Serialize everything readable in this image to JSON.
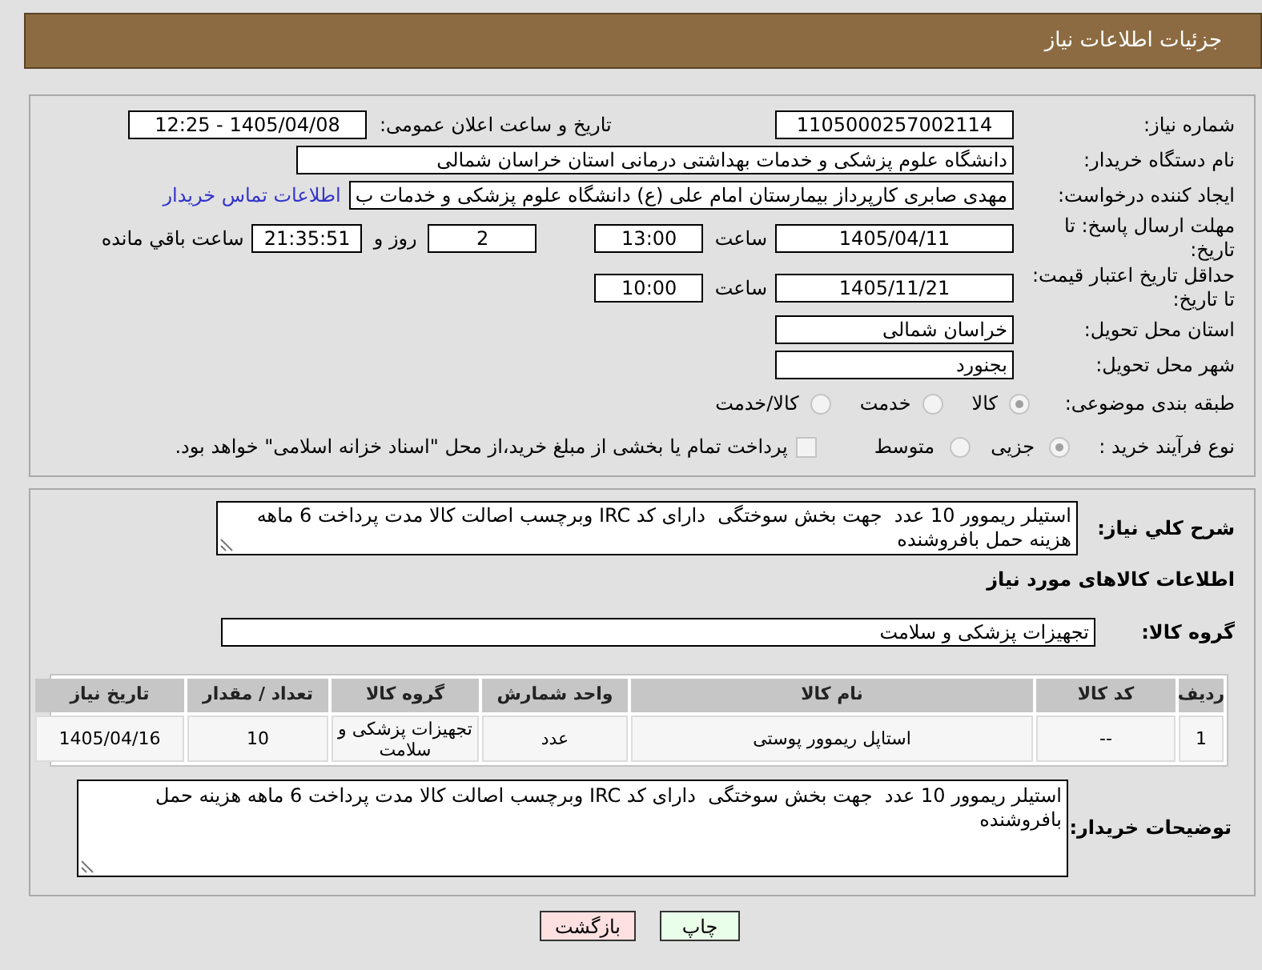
{
  "header": {
    "title": "جزئیات اطلاعات نیاز"
  },
  "fields": {
    "need_number": {
      "label": "شماره نیاز:",
      "value": "1105000257002114"
    },
    "announcement": {
      "label": "تاریخ و ساعت اعلان عمومی:",
      "value": "1405/04/08 - 12:25"
    },
    "buyer_org": {
      "label": "نام دستگاه خریدار:",
      "value": "دانشگاه علوم پزشکی و خدمات بهداشتی درمانی استان خراسان شمالی"
    },
    "requester": {
      "label": "ایجاد کننده درخواست:",
      "value": "مهدی صابری کارپرداز بیمارستان امام علی (ع) دانشگاه علوم پزشکی و خدمات ب",
      "link": "اطلاعات تماس خریدار"
    },
    "response_deadline": {
      "label": "مهلت ارسال پاسخ: تا تاریخ:",
      "date": "1405/04/11",
      "time_label": "ساعت",
      "time": "13:00",
      "days": "2",
      "days_label": "روز و",
      "remaining": "21:35:51",
      "remaining_label": "ساعت باقي مانده"
    },
    "price_validity": {
      "label": "حداقل تاریخ اعتبار قیمت: تا تاریخ:",
      "date": "1405/11/21",
      "time_label": "ساعت",
      "time": "10:00"
    },
    "delivery_province": {
      "label": "استان محل تحویل:",
      "value": "خراسان شمالی"
    },
    "delivery_city": {
      "label": "شهر محل تحویل:",
      "value": "بجنورد"
    },
    "subject_category": {
      "label": "طبقه بندی موضوعی:",
      "options": [
        {
          "label": "کالا",
          "selected": true
        },
        {
          "label": "خدمت",
          "selected": false
        },
        {
          "label": "کالا/خدمت",
          "selected": false
        }
      ]
    },
    "purchase_process": {
      "label": "نوع فرآیند خرید :",
      "options": [
        {
          "label": "جزیی",
          "selected": true
        },
        {
          "label": "متوسط",
          "selected": false
        }
      ],
      "treasury_payment": {
        "label": "پرداخت تمام یا بخشی از مبلغ خرید،از محل \"اسناد خزانه اسلامی\" خواهد بود.",
        "checked": false
      }
    }
  },
  "description": {
    "label": "شرح کلي نياز:",
    "value": "استیلر ریموور 10 عدد  جهت بخش سوختگی  دارای کد IRC وبرچسب اصالت کالا مدت پرداخت 6 ماهه هزینه حمل بافروشنده"
  },
  "goods": {
    "title": "اطلاعات کالاهای مورد نیاز",
    "group_label": "گروه کالا:",
    "group_value": "تجهیزات پزشکی و سلامت",
    "table": {
      "columns": [
        "ردیف",
        "کد کالا",
        "نام کالا",
        "واحد شمارش",
        "گروه کالا",
        "تعداد / مقدار",
        "تاریخ نیاز"
      ],
      "rows": [
        [
          "1",
          "--",
          "استاپل ریموور پوستی",
          "عدد",
          "تجهیزات پزشکی و سلامت",
          "10",
          "1405/04/16"
        ]
      ]
    }
  },
  "buyer_notes": {
    "label": "توضیحات خریدار:",
    "value": "استیلر ریموور 10 عدد  جهت بخش سوختگی  دارای کد IRC وبرچسب اصالت کالا مدت پرداخت 6 ماهه هزینه حمل بافروشنده"
  },
  "buttons": [
    {
      "label": "چاپ",
      "kind": "print"
    },
    {
      "label": "بازگشت",
      "kind": "back"
    }
  ]
}
